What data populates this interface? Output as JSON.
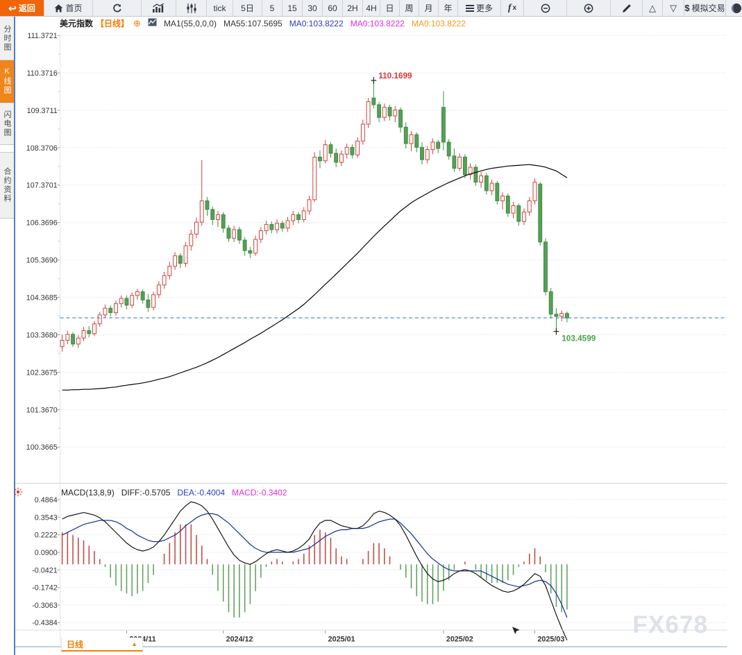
{
  "toolbar": {
    "back_label": "返回",
    "home_label": "首页",
    "tick_label": "tick",
    "d5_label": "5日",
    "m5": "5",
    "m15": "15",
    "m30": "30",
    "m60": "60",
    "h2": "2H",
    "h4": "4H",
    "day": "日",
    "week": "周",
    "month": "月",
    "year": "年",
    "more_label": "更多",
    "fx_f": "f",
    "fx_x": "x",
    "sim_prefix": "$",
    "sim_label": "模拟交易"
  },
  "sidebar": {
    "items": [
      {
        "label": "分时图",
        "active": false
      },
      {
        "label": "K线图",
        "active": true
      },
      {
        "label": "闪电图",
        "active": false
      },
      {
        "label": "合约资料",
        "active": false
      }
    ]
  },
  "price_header": {
    "symbol": "美元指数",
    "period": "【日线】",
    "plus_icon": "⊕",
    "ma_param": "MA1(55,0,0,0)",
    "ma55": "MA55:107.5695",
    "ma0_1": "MA0:103.8222",
    "ma0_2": "MA0:103.8222",
    "ma0_3": "MA0:103.8222"
  },
  "macd_header": {
    "name": "MACD(13,8,9)",
    "diff": "DIFF:-0.5705",
    "dea": "DEA:-0.4004",
    "macd": "MACD:-0.3402"
  },
  "bottom_bar": {
    "period": "日线",
    "arrow": "▲"
  },
  "watermark": "FX678",
  "colors": {
    "up": "#c9413b",
    "up_fill": "#ffffff",
    "down": "#55a057",
    "down_stroke": "#3f8a42",
    "ma_line": "#000000",
    "diff_line": "#111111",
    "dea_line": "#1f3899",
    "hist_pos": "#bf4b45",
    "hist_neg": "#61a161",
    "price_line": "#2e82e0",
    "annotation_red": "#d93636",
    "annotation_green": "#4aa34a",
    "grid": "#d9d9d9",
    "axis_text": "#333333",
    "accent_orange": "#f08300"
  },
  "chart_data": {
    "type": "candlestick",
    "title": "美元指数 日线",
    "y_axis_labels": [
      "111.3721",
      "110.3716",
      "109.3711",
      "108.3706",
      "107.3701",
      "106.3696",
      "105.3690",
      "104.3685",
      "103.3680",
      "102.3675",
      "101.3670",
      "100.3665"
    ],
    "y_axis_top_value": 111.3721,
    "y_axis_step": 1.0005,
    "x_axis_labels": [
      "2024/11",
      "2024/12",
      "2025/01",
      "2025/02",
      "2025/03"
    ],
    "month_tick_indices": [
      12,
      30,
      49,
      71,
      88
    ],
    "last_price": 103.8222,
    "high_annotation": {
      "index": 58,
      "price": 110.1699,
      "text": "110.1699"
    },
    "low_annotation": {
      "index": 92,
      "price": 103.4599,
      "text": "103.4599"
    },
    "candles": [
      [
        103.05,
        103.38,
        102.92,
        103.22
      ],
      [
        103.22,
        103.48,
        103.12,
        103.38
      ],
      [
        103.38,
        103.44,
        103.04,
        103.12
      ],
      [
        103.12,
        103.36,
        103.02,
        103.28
      ],
      [
        103.28,
        103.58,
        103.2,
        103.48
      ],
      [
        103.48,
        103.6,
        103.3,
        103.4
      ],
      [
        103.4,
        103.74,
        103.34,
        103.66
      ],
      [
        103.66,
        103.98,
        103.58,
        103.9
      ],
      [
        103.9,
        104.18,
        103.82,
        104.08
      ],
      [
        104.08,
        104.16,
        103.86,
        103.96
      ],
      [
        103.96,
        104.28,
        103.88,
        104.2
      ],
      [
        104.2,
        104.42,
        104.1,
        104.34
      ],
      [
        104.34,
        104.42,
        104.05,
        104.16
      ],
      [
        104.16,
        104.5,
        104.08,
        104.42
      ],
      [
        104.42,
        104.6,
        104.3,
        104.52
      ],
      [
        104.52,
        104.58,
        104.2,
        104.3
      ],
      [
        104.3,
        104.46,
        103.98,
        104.1
      ],
      [
        104.1,
        104.52,
        104.02,
        104.44
      ],
      [
        104.44,
        104.8,
        104.35,
        104.7
      ],
      [
        104.7,
        105.05,
        104.6,
        104.95
      ],
      [
        104.95,
        105.32,
        104.85,
        105.2
      ],
      [
        105.2,
        105.58,
        105.1,
        105.48
      ],
      [
        105.48,
        105.55,
        105.15,
        105.28
      ],
      [
        105.28,
        105.85,
        105.18,
        105.75
      ],
      [
        105.75,
        106.18,
        105.62,
        106.06
      ],
      [
        106.06,
        106.5,
        105.95,
        106.38
      ],
      [
        106.38,
        108.04,
        106.28,
        106.95
      ],
      [
        106.95,
        107.05,
        106.55,
        106.72
      ],
      [
        106.72,
        106.8,
        106.3,
        106.45
      ],
      [
        106.45,
        106.68,
        106.25,
        106.58
      ],
      [
        106.58,
        106.65,
        106.1,
        106.22
      ],
      [
        106.22,
        106.3,
        105.85,
        105.95
      ],
      [
        105.95,
        106.28,
        105.85,
        106.18
      ],
      [
        106.18,
        106.26,
        105.8,
        105.9
      ],
      [
        105.9,
        105.98,
        105.48,
        105.62
      ],
      [
        105.62,
        105.72,
        105.42,
        105.55
      ],
      [
        105.55,
        106.02,
        105.48,
        105.92
      ],
      [
        105.92,
        106.25,
        105.82,
        106.15
      ],
      [
        106.15,
        106.42,
        106.05,
        106.32
      ],
      [
        106.32,
        106.4,
        106.08,
        106.18
      ],
      [
        106.18,
        106.45,
        106.08,
        106.35
      ],
      [
        106.35,
        106.42,
        106.12,
        106.22
      ],
      [
        106.22,
        106.52,
        106.12,
        106.42
      ],
      [
        106.42,
        106.68,
        106.3,
        106.58
      ],
      [
        106.58,
        106.65,
        106.35,
        106.45
      ],
      [
        106.45,
        106.78,
        106.38,
        106.68
      ],
      [
        106.68,
        107.08,
        106.58,
        106.98
      ],
      [
        106.98,
        108.25,
        106.92,
        108.12
      ],
      [
        108.12,
        108.3,
        107.82,
        108.02
      ],
      [
        108.02,
        108.58,
        107.95,
        108.45
      ],
      [
        108.45,
        108.52,
        108.1,
        108.22
      ],
      [
        108.22,
        108.35,
        107.85,
        107.98
      ],
      [
        107.98,
        108.3,
        107.88,
        108.2
      ],
      [
        108.2,
        108.48,
        108.08,
        108.38
      ],
      [
        108.38,
        108.46,
        108.08,
        108.18
      ],
      [
        108.18,
        108.65,
        108.1,
        108.55
      ],
      [
        108.55,
        109.12,
        108.45,
        109.0
      ],
      [
        109.0,
        109.7,
        108.9,
        109.6
      ],
      [
        109.7,
        110.17,
        109.42,
        109.52
      ],
      [
        109.52,
        109.6,
        109.05,
        109.18
      ],
      [
        109.18,
        109.55,
        109.08,
        109.45
      ],
      [
        109.45,
        109.52,
        109.1,
        109.22
      ],
      [
        109.22,
        109.48,
        109.05,
        109.38
      ],
      [
        109.38,
        109.45,
        108.78,
        108.92
      ],
      [
        108.92,
        109.05,
        108.35,
        108.48
      ],
      [
        108.48,
        108.82,
        108.28,
        108.72
      ],
      [
        108.72,
        108.78,
        108.25,
        108.38
      ],
      [
        108.38,
        108.52,
        107.92,
        108.05
      ],
      [
        108.05,
        108.42,
        107.95,
        108.32
      ],
      [
        108.32,
        108.62,
        108.2,
        108.52
      ],
      [
        108.52,
        108.58,
        108.22,
        108.35
      ],
      [
        109.45,
        109.88,
        108.3,
        108.52
      ],
      [
        108.52,
        108.6,
        108.05,
        108.15
      ],
      [
        108.15,
        108.35,
        107.72,
        107.82
      ],
      [
        107.82,
        108.22,
        107.75,
        108.12
      ],
      [
        108.12,
        108.2,
        107.55,
        107.65
      ],
      [
        107.65,
        107.95,
        107.52,
        107.85
      ],
      [
        107.85,
        107.92,
        107.35,
        107.45
      ],
      [
        107.45,
        107.72,
        107.3,
        107.62
      ],
      [
        107.62,
        107.7,
        107.12,
        107.22
      ],
      [
        107.22,
        107.52,
        107.1,
        107.42
      ],
      [
        107.42,
        107.48,
        106.85,
        106.95
      ],
      [
        106.95,
        107.18,
        106.72,
        107.08
      ],
      [
        107.08,
        107.15,
        106.52,
        106.62
      ],
      [
        106.62,
        106.92,
        106.48,
        106.82
      ],
      [
        106.82,
        106.88,
        106.28,
        106.4
      ],
      [
        106.4,
        106.75,
        106.3,
        106.65
      ],
      [
        106.65,
        107.05,
        106.55,
        106.95
      ],
      [
        106.95,
        107.55,
        106.85,
        107.45
      ],
      [
        107.4,
        107.45,
        105.75,
        105.85
      ],
      [
        105.85,
        105.95,
        104.42,
        104.52
      ],
      [
        104.52,
        104.62,
        103.8,
        103.92
      ],
      [
        103.92,
        104.08,
        103.46,
        103.86
      ],
      [
        103.86,
        104.02,
        103.72,
        103.94
      ],
      [
        103.94,
        103.99,
        103.7,
        103.82
      ]
    ],
    "ma55": [
      101.89,
      101.89,
      101.9,
      101.9,
      101.91,
      101.91,
      101.92,
      101.93,
      101.94,
      101.96,
      101.97,
      102.0,
      102.02,
      102.04,
      102.06,
      102.08,
      102.11,
      102.14,
      102.18,
      102.21,
      102.25,
      102.3,
      102.35,
      102.4,
      102.45,
      102.5,
      102.56,
      102.62,
      102.69,
      102.76,
      102.84,
      102.92,
      103.0,
      103.08,
      103.16,
      103.25,
      103.33,
      103.41,
      103.5,
      103.59,
      103.68,
      103.77,
      103.87,
      103.97,
      104.07,
      104.18,
      104.31,
      104.44,
      104.58,
      104.72,
      104.85,
      104.99,
      105.13,
      105.27,
      105.41,
      105.55,
      105.7,
      105.85,
      106.0,
      106.14,
      106.28,
      106.41,
      106.55,
      106.68,
      106.79,
      106.9,
      106.99,
      107.07,
      107.15,
      107.23,
      107.3,
      107.37,
      107.44,
      107.5,
      107.56,
      107.62,
      107.67,
      107.71,
      107.75,
      107.79,
      107.82,
      107.84,
      107.86,
      107.88,
      107.89,
      107.9,
      107.91,
      107.92,
      107.9,
      107.88,
      107.85,
      107.8,
      107.75,
      107.66,
      107.57
    ],
    "macd": {
      "params": "MACD(13,8,9)",
      "y_axis_labels": [
        "0.4864",
        "0.3543",
        "0.2222",
        "0.0900",
        "-0.0421",
        "-0.1742",
        "-0.3063",
        "-0.4384"
      ],
      "y_axis_top_value": 0.4864,
      "y_axis_step": 0.1321,
      "hist_formula": "2*(diff-dea)",
      "diff": [
        0.34,
        0.36,
        0.37,
        0.38,
        0.39,
        0.38,
        0.37,
        0.35,
        0.32,
        0.28,
        0.24,
        0.2,
        0.16,
        0.13,
        0.11,
        0.1,
        0.11,
        0.13,
        0.17,
        0.22,
        0.28,
        0.34,
        0.4,
        0.44,
        0.47,
        0.46,
        0.44,
        0.4,
        0.34,
        0.27,
        0.2,
        0.13,
        0.07,
        0.03,
        0.01,
        0.0,
        0.02,
        0.05,
        0.08,
        0.1,
        0.11,
        0.1,
        0.09,
        0.1,
        0.12,
        0.15,
        0.19,
        0.26,
        0.31,
        0.33,
        0.33,
        0.31,
        0.29,
        0.28,
        0.27,
        0.27,
        0.29,
        0.33,
        0.38,
        0.4,
        0.39,
        0.37,
        0.34,
        0.29,
        0.22,
        0.14,
        0.06,
        -0.01,
        -0.07,
        -0.11,
        -0.13,
        -0.12,
        -0.1,
        -0.07,
        -0.05,
        -0.04,
        -0.05,
        -0.07,
        -0.1,
        -0.13,
        -0.16,
        -0.18,
        -0.2,
        -0.21,
        -0.2,
        -0.18,
        -0.15,
        -0.11,
        -0.07,
        -0.09,
        -0.16,
        -0.27,
        -0.38,
        -0.48,
        -0.57
      ],
      "dea": [
        0.22,
        0.24,
        0.26,
        0.28,
        0.3,
        0.31,
        0.32,
        0.33,
        0.33,
        0.33,
        0.32,
        0.3,
        0.27,
        0.25,
        0.22,
        0.2,
        0.18,
        0.17,
        0.17,
        0.18,
        0.2,
        0.22,
        0.25,
        0.29,
        0.32,
        0.35,
        0.37,
        0.38,
        0.38,
        0.37,
        0.34,
        0.31,
        0.27,
        0.23,
        0.19,
        0.15,
        0.12,
        0.1,
        0.09,
        0.09,
        0.09,
        0.09,
        0.09,
        0.09,
        0.1,
        0.11,
        0.12,
        0.15,
        0.18,
        0.21,
        0.23,
        0.25,
        0.26,
        0.26,
        0.27,
        0.27,
        0.27,
        0.28,
        0.3,
        0.32,
        0.33,
        0.34,
        0.34,
        0.31,
        0.27,
        0.23,
        0.18,
        0.13,
        0.08,
        0.04,
        0.01,
        -0.02,
        -0.04,
        -0.05,
        -0.05,
        -0.05,
        -0.05,
        -0.05,
        -0.05,
        -0.07,
        -0.09,
        -0.11,
        -0.13,
        -0.15,
        -0.16,
        -0.17,
        -0.16,
        -0.15,
        -0.13,
        -0.12,
        -0.13,
        -0.16,
        -0.22,
        -0.3,
        -0.4
      ]
    }
  }
}
